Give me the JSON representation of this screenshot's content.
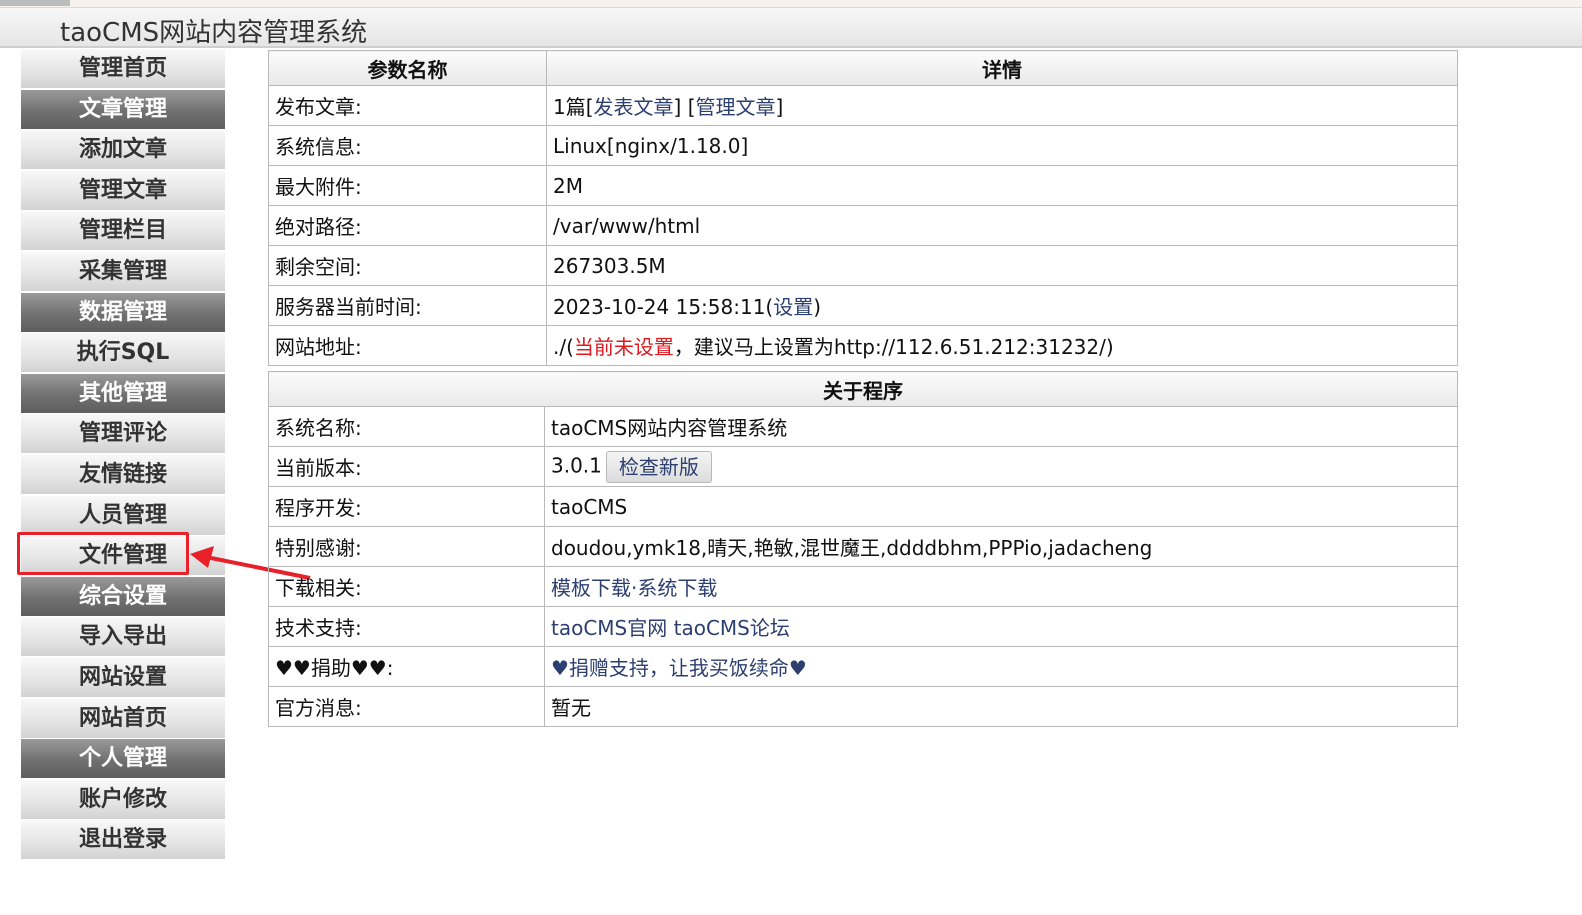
{
  "header": {
    "title": "taoCMS网站内容管理系统"
  },
  "sidebar": {
    "items": [
      {
        "label": "管理首页",
        "type": "link"
      },
      {
        "label": "文章管理",
        "type": "section"
      },
      {
        "label": "添加文章",
        "type": "link"
      },
      {
        "label": "管理文章",
        "type": "link"
      },
      {
        "label": "管理栏目",
        "type": "link"
      },
      {
        "label": "采集管理",
        "type": "link"
      },
      {
        "label": "数据管理",
        "type": "section"
      },
      {
        "label": "执行SQL",
        "type": "link"
      },
      {
        "label": "其他管理",
        "type": "section"
      },
      {
        "label": "管理评论",
        "type": "link"
      },
      {
        "label": "友情链接",
        "type": "link"
      },
      {
        "label": "人员管理",
        "type": "link"
      },
      {
        "label": "文件管理",
        "type": "link"
      },
      {
        "label": "综合设置",
        "type": "section"
      },
      {
        "label": "导入导出",
        "type": "link"
      },
      {
        "label": "网站设置",
        "type": "link"
      },
      {
        "label": "网站首页",
        "type": "link"
      },
      {
        "label": "个人管理",
        "type": "section"
      },
      {
        "label": "账户修改",
        "type": "link"
      },
      {
        "label": "退出登录",
        "type": "link"
      }
    ]
  },
  "system_table": {
    "headers": {
      "param": "参数名称",
      "detail": "详情"
    },
    "publish": {
      "label": "发布文章:",
      "count": "1篇",
      "open_bracket": "[",
      "publish_link": "发表文章",
      "close_bracket": "]",
      "open_bracket2": "[",
      "manage_link": "管理文章",
      "close_bracket2": "]"
    },
    "sysinfo": {
      "label": "系统信息:",
      "value": "Linux[nginx/1.18.0]"
    },
    "max_attach": {
      "label": "最大附件:",
      "value": "2M"
    },
    "abs_path": {
      "label": "绝对路径:",
      "value": "/var/www/html"
    },
    "free_space": {
      "label": "剩余空间:",
      "value": "267303.5M"
    },
    "server_time": {
      "label": "服务器当前时间:",
      "value": "2023-10-24 15:58:11(",
      "link": "设置",
      "suffix": ")"
    },
    "site_url": {
      "label": "网站地址:",
      "prefix": "./(",
      "warn": "当前未设置",
      "suffix": "，建议马上设置为http://112.6.51.212:31232/)"
    }
  },
  "about_table": {
    "header": "关于程序",
    "rows": {
      "name": {
        "label": "系统名称:",
        "value": "taoCMS网站内容管理系统"
      },
      "version": {
        "label": "当前版本:",
        "value": "3.0.1",
        "button": "检查新版"
      },
      "developer": {
        "label": "程序开发:",
        "value": "taoCMS"
      },
      "thanks": {
        "label": "特别感谢:",
        "value": "doudou,ymk18,晴天,艳敏,混世魔王,ddddbhm,PPPio,jadacheng"
      },
      "downloads": {
        "label": "下载相关:",
        "link1": "模板下载",
        "sep": "·",
        "link2": "系统下载"
      },
      "support": {
        "label": "技术支持:",
        "link1": "taoCMS官网",
        "link2": "taoCMS论坛"
      },
      "donate": {
        "label": "♥♥捐助♥♥:",
        "link": "♥捐赠支持，让我买饭续命♥"
      },
      "news": {
        "label": "官方消息:",
        "value": "暂无"
      }
    }
  },
  "colors": {
    "annotation": "#e8202a",
    "section_bg": "#707070",
    "link_bg": "#e4e4e4",
    "link_text": "#2d3f70",
    "warn_text": "#e0191f"
  }
}
